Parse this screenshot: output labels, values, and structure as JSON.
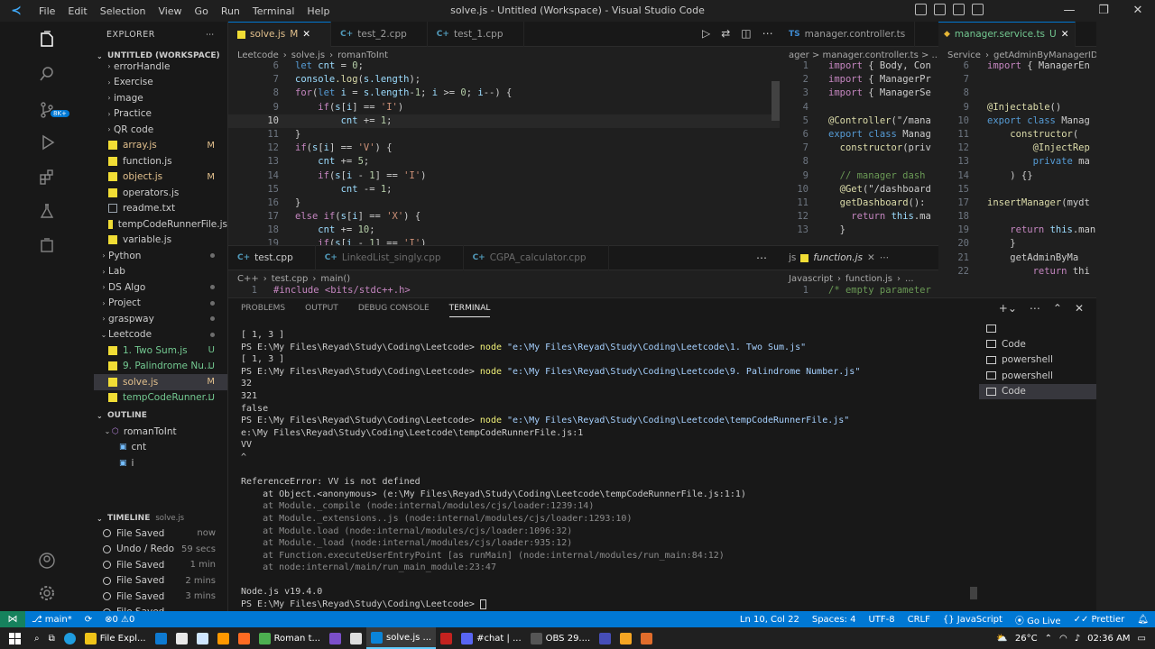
{
  "window": {
    "title": "solve.js - Untitled (Workspace) - Visual Studio Code",
    "menu": [
      "File",
      "Edit",
      "Selection",
      "View",
      "Go",
      "Run",
      "Terminal",
      "Help"
    ]
  },
  "explorer": {
    "header": "EXPLORER",
    "workspace": "UNTITLED (WORKSPACE)",
    "items": [
      {
        "label": "errorHandle",
        "kind": "folder",
        "status": ""
      },
      {
        "label": "Exercise",
        "kind": "folder",
        "status": ""
      },
      {
        "label": "image",
        "kind": "folder",
        "status": ""
      },
      {
        "label": "Practice",
        "kind": "folder",
        "status": ""
      },
      {
        "label": "QR code",
        "kind": "folder",
        "status": ""
      },
      {
        "label": "array.js",
        "kind": "js",
        "status": "M"
      },
      {
        "label": "function.js",
        "kind": "js",
        "status": ""
      },
      {
        "label": "object.js",
        "kind": "js",
        "status": "M"
      },
      {
        "label": "operators.js",
        "kind": "js",
        "status": ""
      },
      {
        "label": "readme.txt",
        "kind": "txt",
        "status": ""
      },
      {
        "label": "tempCodeRunnerFile.js",
        "kind": "js",
        "status": ""
      },
      {
        "label": "variable.js",
        "kind": "js",
        "status": ""
      },
      {
        "label": "Python",
        "kind": "root",
        "status": "dot"
      },
      {
        "label": "Lab",
        "kind": "root",
        "status": ""
      },
      {
        "label": "DS Algo",
        "kind": "root",
        "status": "dot"
      },
      {
        "label": "Project",
        "kind": "root",
        "status": "dot"
      },
      {
        "label": "graspway",
        "kind": "root",
        "status": "dot"
      },
      {
        "label": "Leetcode",
        "kind": "rootopen",
        "status": "dot"
      },
      {
        "label": "1. Two Sum.js",
        "kind": "js",
        "status": "U"
      },
      {
        "label": "9. Palindrome Nu...",
        "kind": "js",
        "status": "U"
      },
      {
        "label": "solve.js",
        "kind": "js",
        "status": "M"
      },
      {
        "label": "tempCodeRunner...",
        "kind": "js",
        "status": "U"
      }
    ]
  },
  "outline": {
    "header": "OUTLINE",
    "items": [
      {
        "label": "romanToInt",
        "level": 0
      },
      {
        "label": "cnt",
        "level": 1
      },
      {
        "label": "i",
        "level": 1
      }
    ]
  },
  "timeline": {
    "header": "TIMELINE",
    "file": "solve.js",
    "items": [
      {
        "label": "File Saved",
        "time": "now"
      },
      {
        "label": "Undo / Redo",
        "time": "59 secs"
      },
      {
        "label": "File Saved",
        "time": "1 min"
      },
      {
        "label": "File Saved",
        "time": "2 mins"
      },
      {
        "label": "File Saved",
        "time": "3 mins"
      },
      {
        "label": "File Saved",
        "time": ""
      }
    ]
  },
  "editor_main": {
    "tabs": [
      {
        "label": "solve.js",
        "status": "M",
        "active": true
      },
      {
        "label": "test_2.cpp",
        "status": "",
        "active": false
      },
      {
        "label": "test_1.cpp",
        "status": "",
        "active": false
      }
    ],
    "breadcrumb": [
      "Leetcode",
      "solve.js",
      "romanToInt"
    ],
    "first_line": 6,
    "current_line": 10,
    "lines": [
      "let cnt = 0;",
      "console.log(s.length);",
      "for(let i = s.length-1; i >= 0; i--) {",
      "    if(s[i] == 'I')",
      "        cnt += 1;",
      "}",
      "if(s[i] == 'V') {",
      "    cnt += 5;",
      "    if(s[i - 1] == 'I')",
      "        cnt -= 1;",
      "}",
      "else if(s[i] == 'X') {",
      "    cnt += 10;",
      "    if(s[i - 1] == 'I')"
    ]
  },
  "editor_lower": {
    "tabs": [
      "test.cpp",
      "LinkedList_singly.cpp",
      "CGPA_calculator.cpp"
    ],
    "breadcrumb": [
      "C++",
      "test.cpp",
      "main()"
    ],
    "line": "#include <bits/stdc++.h>"
  },
  "editor_controller": {
    "tab": "manager.controller.ts",
    "breadcrumb": "ager > manager.controller.ts > ...",
    "lines": [
      {
        "n": "1",
        "code": "import { Body, Con"
      },
      {
        "n": "2",
        "code": "import { ManagerPr"
      },
      {
        "n": "3",
        "code": "import { ManagerSe"
      },
      {
        "n": "4",
        "code": ""
      },
      {
        "n": "5",
        "code": "@Controller(\"/mana"
      },
      {
        "n": "6",
        "code": "export class Manag"
      },
      {
        "n": "7",
        "code": "  constructor(priv"
      },
      {
        "n": "8",
        "code": ""
      },
      {
        "n": "9",
        "code": "  // manager dash"
      },
      {
        "n": "10",
        "code": "  @Get(\"/dashboard"
      },
      {
        "n": "11",
        "code": "  getDashboard():"
      },
      {
        "n": "12",
        "code": "    return this.ma"
      },
      {
        "n": "13",
        "code": "  }"
      }
    ],
    "lower_tab": "function.js",
    "lower_tab_prefix": "js",
    "lower_breadcrumb": [
      "Javascript",
      "function.js",
      "..."
    ],
    "lower_line": {
      "n": "1",
      "code": "/* empty parameter"
    }
  },
  "editor_service": {
    "tab": "manager.service.ts",
    "tab_status": "U",
    "breadcrumb": [
      "Service",
      "getAdminByManagerID"
    ],
    "lines": [
      {
        "n": "6",
        "code": "import { ManagerEn"
      },
      {
        "n": "7",
        "code": ""
      },
      {
        "n": "8",
        "code": ""
      },
      {
        "n": "9",
        "code": "@Injectable()"
      },
      {
        "n": "10",
        "code": "export class Manag"
      },
      {
        "n": "11",
        "code": "    constructor("
      },
      {
        "n": "12",
        "code": "        @InjectRep"
      },
      {
        "n": "13",
        "code": "        private ma"
      },
      {
        "n": "14",
        "code": "    ) {}"
      },
      {
        "n": "15",
        "code": ""
      },
      {
        "n": "17",
        "code": "insertManager(mydt"
      },
      {
        "n": "18",
        "code": ""
      },
      {
        "n": "19",
        "code": "    return this.man"
      },
      {
        "n": "20",
        "code": "    }"
      },
      {
        "n": "21",
        "code": "    getAdminByMa"
      },
      {
        "n": "22",
        "code": "        return thi"
      }
    ]
  },
  "panel": {
    "tabs": [
      "PROBLEMS",
      "OUTPUT",
      "DEBUG CONSOLE",
      "TERMINAL"
    ],
    "active_tab": "TERMINAL",
    "terminal_lines": [
      {
        "text": "[ 1, 3 ]",
        "style": ""
      },
      {
        "prompt": "PS E:\\My Files\\Reyad\\Study\\Coding\\Leetcode> ",
        "cmd": "node ",
        "arg": "\"e:\\My Files\\Reyad\\Study\\Coding\\Leetcode\\1. Two Sum.js\""
      },
      {
        "text": "[ 1, 3 ]",
        "style": ""
      },
      {
        "prompt": "PS E:\\My Files\\Reyad\\Study\\Coding\\Leetcode> ",
        "cmd": "node ",
        "arg": "\"e:\\My Files\\Reyad\\Study\\Coding\\Leetcode\\9. Palindrome Number.js\""
      },
      {
        "text": "32",
        "style": ""
      },
      {
        "text": "321",
        "style": ""
      },
      {
        "text": "false",
        "style": ""
      },
      {
        "prompt": "PS E:\\My Files\\Reyad\\Study\\Coding\\Leetcode> ",
        "cmd": "node ",
        "arg": "\"e:\\My Files\\Reyad\\Study\\Coding\\Leetcode\\tempCodeRunnerFile.js\""
      },
      {
        "text": "e:\\My Files\\Reyad\\Study\\Coding\\Leetcode\\tempCodeRunnerFile.js:1",
        "style": ""
      },
      {
        "text": "VV",
        "style": ""
      },
      {
        "text": "^",
        "style": ""
      },
      {
        "text": "",
        "style": ""
      },
      {
        "text": "ReferenceError: VV is not defined",
        "style": ""
      },
      {
        "text": "    at Object.<anonymous> (e:\\My Files\\Reyad\\Study\\Coding\\Leetcode\\tempCodeRunnerFile.js:1:1)",
        "style": ""
      },
      {
        "text": "    at Module._compile (node:internal/modules/cjs/loader:1239:14)",
        "style": "gray"
      },
      {
        "text": "    at Module._extensions..js (node:internal/modules/cjs/loader:1293:10)",
        "style": "gray"
      },
      {
        "text": "    at Module.load (node:internal/modules/cjs/loader:1096:32)",
        "style": "gray"
      },
      {
        "text": "    at Module._load (node:internal/modules/cjs/loader:935:12)",
        "style": "gray"
      },
      {
        "text": "    at Function.executeUserEntryPoint [as runMain] (node:internal/modules/run_main:84:12)",
        "style": "gray"
      },
      {
        "text": "    at node:internal/main/run_main_module:23:47",
        "style": "gray"
      },
      {
        "text": "",
        "style": ""
      },
      {
        "text": "Node.js v19.4.0",
        "style": ""
      },
      {
        "prompt": "PS E:\\My Files\\Reyad\\Study\\Coding\\Leetcode> ",
        "cmd": "",
        "arg": ""
      }
    ],
    "terminal_instances": [
      "Code",
      "powershell",
      "powershell",
      "Code"
    ]
  },
  "statusbar": {
    "branch": "main*",
    "problems": "0",
    "warnings": "0",
    "position": "Ln 10, Col 22",
    "spaces": "Spaces: 4",
    "encoding": "UTF-8",
    "eol": "CRLF",
    "language": "JavaScript",
    "golive": "Go Live",
    "prettier": "Prettier"
  },
  "taskbar": {
    "items": [
      {
        "label": "File Expl...",
        "color": "#f0c419"
      },
      {
        "label": "Roman t...",
        "color": "#4caf50"
      },
      {
        "label": "solve.js ...",
        "color": "#0a84d8"
      },
      {
        "label": "#chat | ...",
        "color": "#5865f2"
      },
      {
        "label": "OBS 29....",
        "color": "#555555"
      }
    ],
    "temperature": "26°C",
    "time": "02:36 AM"
  }
}
